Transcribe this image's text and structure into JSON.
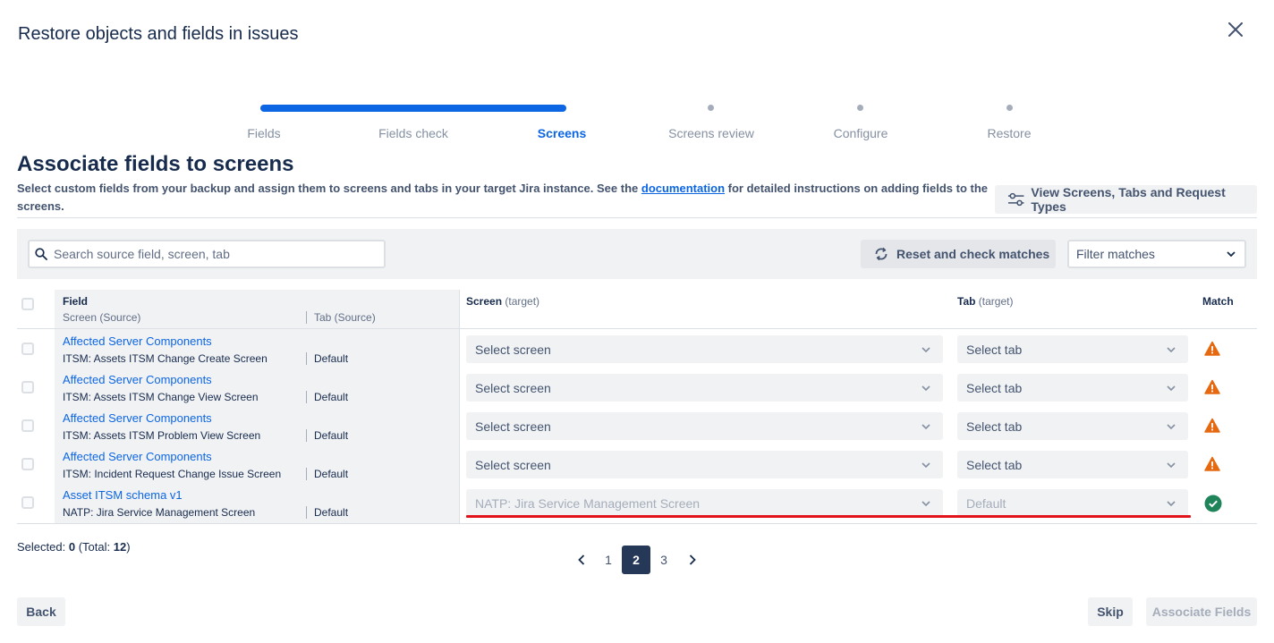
{
  "dialog": {
    "title": "Restore objects and fields in issues"
  },
  "stepper": {
    "steps": [
      "Fields",
      "Fields check",
      "Screens",
      "Screens review",
      "Configure",
      "Restore"
    ],
    "active_index": 2,
    "progress_fraction": 0.5
  },
  "section": {
    "title": "Associate fields to screens",
    "desc_before": "Select custom fields from your backup and assign them to screens and tabs in your target Jira instance. See the ",
    "desc_link": "documentation",
    "desc_after": " for detailed instructions on adding fields to the screens.",
    "view_button": "View Screens, Tabs and Request Types"
  },
  "toolbar": {
    "search_placeholder": "Search source field, screen, tab",
    "reset_button": "Reset and check matches",
    "filter_placeholder": "Filter matches"
  },
  "table": {
    "headers": {
      "field": "Field",
      "source_screen": "Screen (Source)",
      "source_tab": "Tab (Source)",
      "screen": "Screen",
      "screen_suffix": "(target)",
      "tab": "Tab",
      "tab_suffix": "(target)",
      "match": "Match"
    },
    "rows": [
      {
        "field": "Affected Server Components",
        "source_screen": "ITSM: Assets ITSM Change Create Screen",
        "source_tab": "Default",
        "target_screen": "Select screen",
        "target_tab": "Select tab",
        "match": "warning",
        "disabled": false
      },
      {
        "field": "Affected Server Components",
        "source_screen": "ITSM: Assets ITSM Change View Screen",
        "source_tab": "Default",
        "target_screen": "Select screen",
        "target_tab": "Select tab",
        "match": "warning",
        "disabled": false
      },
      {
        "field": "Affected Server Components",
        "source_screen": "ITSM: Assets ITSM Problem View Screen",
        "source_tab": "Default",
        "target_screen": "Select screen",
        "target_tab": "Select tab",
        "match": "warning",
        "disabled": false
      },
      {
        "field": "Affected Server Components",
        "source_screen": "ITSM: Incident Request Change Issue Screen",
        "source_tab": "Default",
        "target_screen": "Select screen",
        "target_tab": "Select tab",
        "match": "warning",
        "disabled": false
      },
      {
        "field": "Asset ITSM schema v1",
        "source_screen": "NATP: Jira Service Management Screen",
        "source_tab": "Default",
        "target_screen": "NATP: Jira Service Management Screen",
        "target_tab": "Default",
        "match": "success",
        "disabled": true
      }
    ]
  },
  "selection": {
    "label": "Selected:",
    "count": "0",
    "total_label": "(Total:",
    "total": "12",
    "close": ")"
  },
  "pagination": {
    "pages": [
      "1",
      "2",
      "3"
    ],
    "current": "2"
  },
  "footer": {
    "back": "Back",
    "skip": "Skip",
    "associate": "Associate Fields"
  },
  "colors": {
    "accent": "#0c66e4",
    "warning": "#e56910",
    "success": "#1f845a",
    "annotation": "#e2131a",
    "current_page": "#253858"
  }
}
